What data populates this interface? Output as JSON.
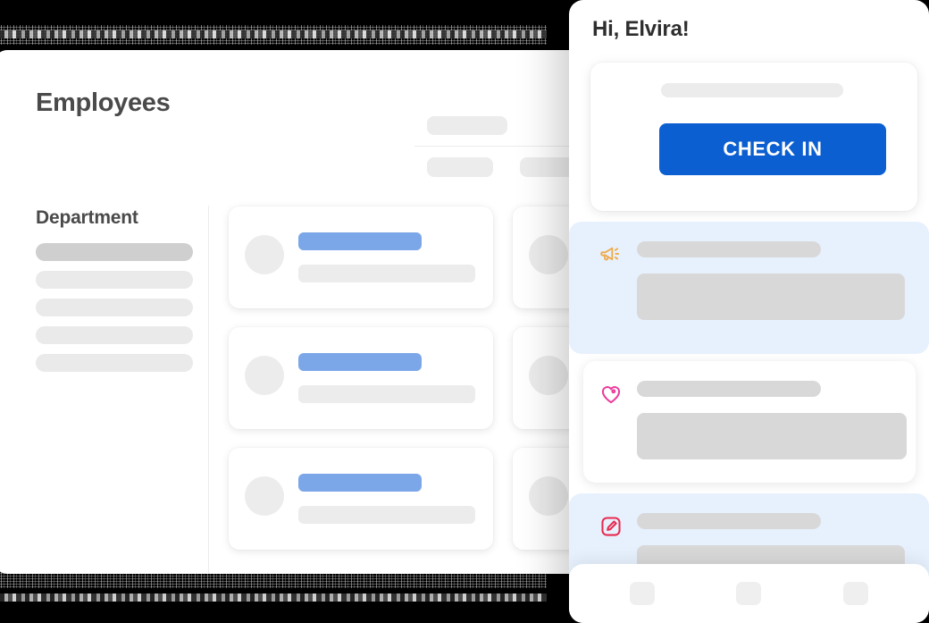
{
  "desktop": {
    "page_title": "Employees",
    "sidebar": {
      "heading": "Department",
      "items": [
        {
          "name": "department-item-1",
          "selected": true
        },
        {
          "name": "department-item-2",
          "selected": false
        },
        {
          "name": "department-item-3",
          "selected": false
        },
        {
          "name": "department-item-4",
          "selected": false
        },
        {
          "name": "department-item-5",
          "selected": false
        }
      ]
    },
    "toolbar_placeholders": [
      {
        "name": "toolbar-skeleton-top"
      },
      {
        "name": "toolbar-skeleton-left"
      },
      {
        "name": "toolbar-skeleton-right"
      }
    ],
    "employee_cards": [
      {
        "name": "employee-card-1",
        "accent": "#7ba7e8"
      },
      {
        "name": "employee-card-2",
        "accent": "#7ba7e8"
      },
      {
        "name": "employee-card-3",
        "accent": "#7ba7e8"
      },
      {
        "name": "employee-card-4",
        "accent": "#7ba7e8"
      },
      {
        "name": "employee-card-5",
        "accent": "#7ba7e8"
      },
      {
        "name": "employee-card-6",
        "accent": "#7ba7e8"
      }
    ]
  },
  "phone": {
    "greeting": "Hi, Elvira!",
    "check_in": {
      "button_label": "CHECK IN",
      "button_color": "#0b5fd0"
    },
    "feed": [
      {
        "icon": "megaphone-icon",
        "icon_color": "#f0ab4a",
        "highlighted": true,
        "background": "#e7f1fd"
      },
      {
        "icon": "heart-icon",
        "icon_color": "#ec3b9b",
        "highlighted": false,
        "background": "#ffffff"
      },
      {
        "icon": "edit-square-icon",
        "icon_color": "#e8294f",
        "highlighted": true,
        "background": "#e7f1fd"
      }
    ],
    "bottom_nav": [
      {
        "name": "nav-item-1"
      },
      {
        "name": "nav-item-2"
      },
      {
        "name": "nav-item-3"
      }
    ]
  },
  "colors": {
    "primary_blue": "#0b5fd0",
    "accent_blue": "#7ba7e8",
    "highlight_blue": "#e7f1fd",
    "skeleton_light": "#ececec",
    "skeleton_dark": "#d8d8d8",
    "text_dark": "#2e2e2e",
    "text_muted": "#4a4a4a"
  }
}
